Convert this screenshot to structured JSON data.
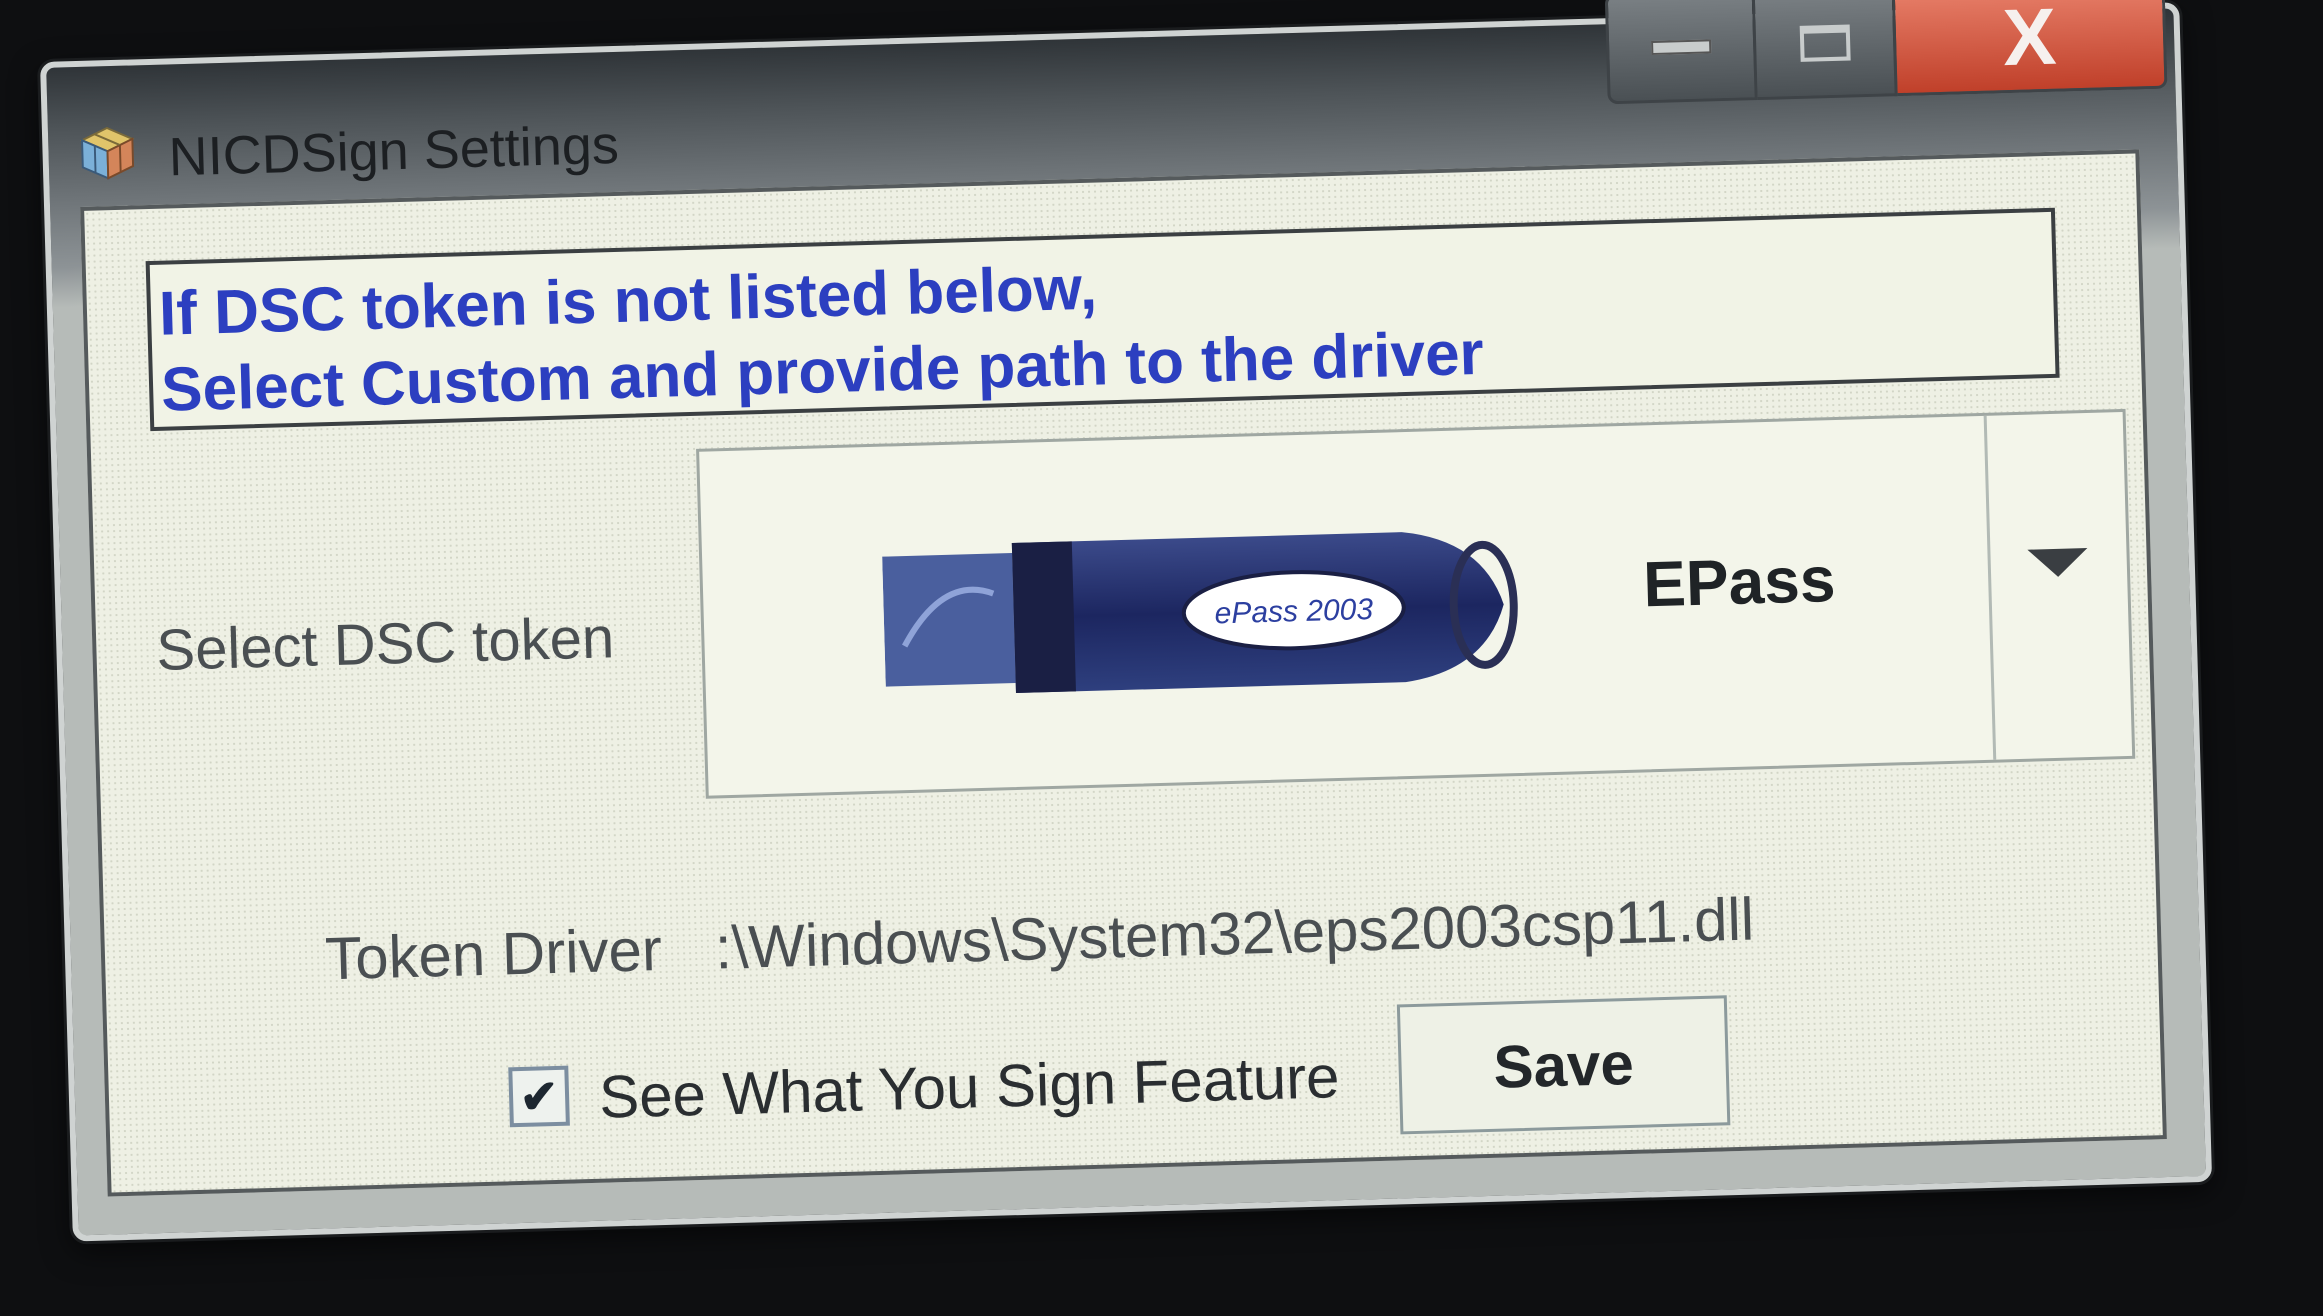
{
  "window": {
    "title": "NICDSign Settings"
  },
  "title_controls": {
    "minimize_icon": "minimize-icon",
    "maximize_icon": "maximize-icon",
    "close_glyph": "X"
  },
  "info": {
    "line1": "If DSC token is not listed below,",
    "line2": "Select Custom and provide path to the driver"
  },
  "token_select": {
    "label": "Select DSC token",
    "selected_value": "EPass",
    "token_image_text": "ePass 2003"
  },
  "driver": {
    "label": "Token Driver",
    "path": ":\\Windows\\System32\\eps2003csp11.dll"
  },
  "options": {
    "check_glyph": "✔",
    "wys_checked": true,
    "wys_label": "See What You Sign Feature"
  },
  "actions": {
    "save_label": "Save"
  },
  "colors": {
    "info_text": "#2c3fc0",
    "close_button": "#c0402a",
    "dialog_bg": "#eef0e4"
  }
}
